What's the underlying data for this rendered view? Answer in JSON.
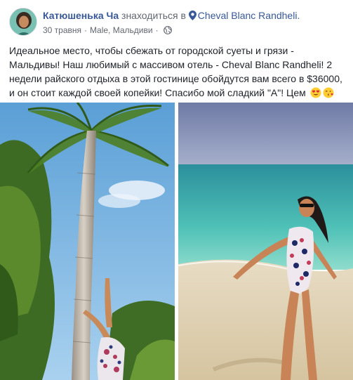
{
  "header": {
    "author": "Катюшенька Ча",
    "verb": "знаходиться в",
    "place": "Cheval Blanc Randheli.",
    "date": "30 травня",
    "separator": "·",
    "location": "Male, Мальдиви",
    "privacy_icon": "globe-icon",
    "avatar_icon": "profile-photo"
  },
  "post": {
    "text": "Идеальное место, чтобы сбежать от городской суеты и грязи - Мальдивы! Наш любимый с массивом отель - Cheval Blanc Randheli! 2 недели райского отдыха в этой гостинице обойдутся вам всего в $36000, и он стоит каждой своей копейки! Спасибо мой сладкий \"А\"! Цем",
    "emojis": [
      "heart-eyes-emoji",
      "kissing-emoji"
    ]
  },
  "photos": [
    {
      "subject": "palm-tree-handstand-photo"
    },
    {
      "subject": "beach-swimsuit-photo"
    }
  ],
  "colors": {
    "link": "#385898",
    "secondary": "#616770",
    "text": "#1d2129"
  }
}
